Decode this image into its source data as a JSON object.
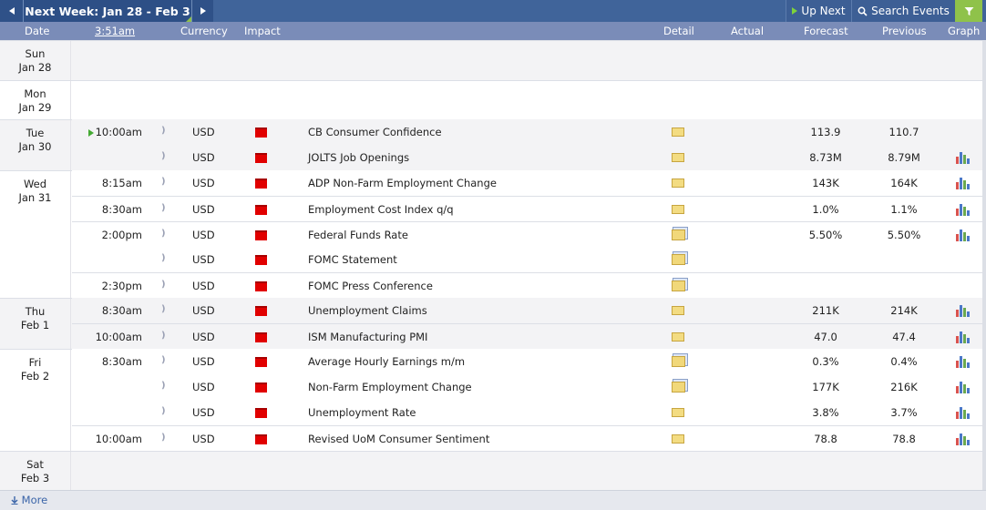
{
  "toolbar": {
    "prev_icon": "chevron-left-icon",
    "week_label": "Next Week: Jan 28 - Feb 3",
    "next_icon": "chevron-right-icon",
    "up_next_label": "Up Next",
    "search_label": "Search Events",
    "filter_icon": "filter-icon",
    "accent": "#8fc24a"
  },
  "header": {
    "date": "Date",
    "time": "3:51am",
    "currency": "Currency",
    "impact": "Impact",
    "detail": "Detail",
    "actual": "Actual",
    "forecast": "Forecast",
    "previous": "Previous",
    "graph": "Graph"
  },
  "days": [
    {
      "day": "Sun",
      "date": "Jan 28"
    },
    {
      "day": "Mon",
      "date": "Jan 29"
    },
    {
      "day": "Tue",
      "date": "Jan 30"
    },
    {
      "day": "Wed",
      "date": "Jan 31"
    },
    {
      "day": "Thu",
      "date": "Feb 1"
    },
    {
      "day": "Fri",
      "date": "Feb 2"
    },
    {
      "day": "Sat",
      "date": "Feb 3"
    }
  ],
  "events": [
    {
      "time": "10:00am",
      "currency": "USD",
      "event": "CB Consumer Confidence",
      "forecast": "113.9",
      "previous": "110.7",
      "detail_type": "folder",
      "graph": false,
      "upcoming": true
    },
    {
      "time": "",
      "currency": "USD",
      "event": "JOLTS Job Openings",
      "forecast": "8.73M",
      "previous": "8.79M",
      "detail_type": "folder",
      "graph": true
    },
    {
      "time": "8:15am",
      "currency": "USD",
      "event": "ADP Non-Farm Employment Change",
      "forecast": "143K",
      "previous": "164K",
      "detail_type": "folder",
      "graph": true
    },
    {
      "time": "8:30am",
      "currency": "USD",
      "event": "Employment Cost Index q/q",
      "forecast": "1.0%",
      "previous": "1.1%",
      "detail_type": "folder",
      "graph": true
    },
    {
      "time": "2:00pm",
      "currency": "USD",
      "event": "Federal Funds Rate",
      "forecast": "5.50%",
      "previous": "5.50%",
      "detail_type": "doc",
      "graph": true
    },
    {
      "time": "",
      "currency": "USD",
      "event": "FOMC Statement",
      "forecast": "",
      "previous": "",
      "detail_type": "doc",
      "graph": false
    },
    {
      "time": "2:30pm",
      "currency": "USD",
      "event": "FOMC Press Conference",
      "forecast": "",
      "previous": "",
      "detail_type": "doc",
      "graph": false
    },
    {
      "time": "8:30am",
      "currency": "USD",
      "event": "Unemployment Claims",
      "forecast": "211K",
      "previous": "214K",
      "detail_type": "folder",
      "graph": true
    },
    {
      "time": "10:00am",
      "currency": "USD",
      "event": "ISM Manufacturing PMI",
      "forecast": "47.0",
      "previous": "47.4",
      "detail_type": "folder",
      "graph": true
    },
    {
      "time": "8:30am",
      "currency": "USD",
      "event": "Average Hourly Earnings m/m",
      "forecast": "0.3%",
      "previous": "0.4%",
      "detail_type": "doc",
      "graph": true
    },
    {
      "time": "",
      "currency": "USD",
      "event": "Non-Farm Employment Change",
      "forecast": "177K",
      "previous": "216K",
      "detail_type": "doc",
      "graph": true
    },
    {
      "time": "",
      "currency": "USD",
      "event": "Unemployment Rate",
      "forecast": "3.8%",
      "previous": "3.7%",
      "detail_type": "folder",
      "graph": true
    },
    {
      "time": "10:00am",
      "currency": "USD",
      "event": "Revised UoM Consumer Sentiment",
      "forecast": "78.8",
      "previous": "78.8",
      "detail_type": "folder",
      "graph": true
    }
  ],
  "impact_color": "#e10000",
  "footer": {
    "more_label": "More",
    "more_icon": "download-arrow-icon"
  }
}
